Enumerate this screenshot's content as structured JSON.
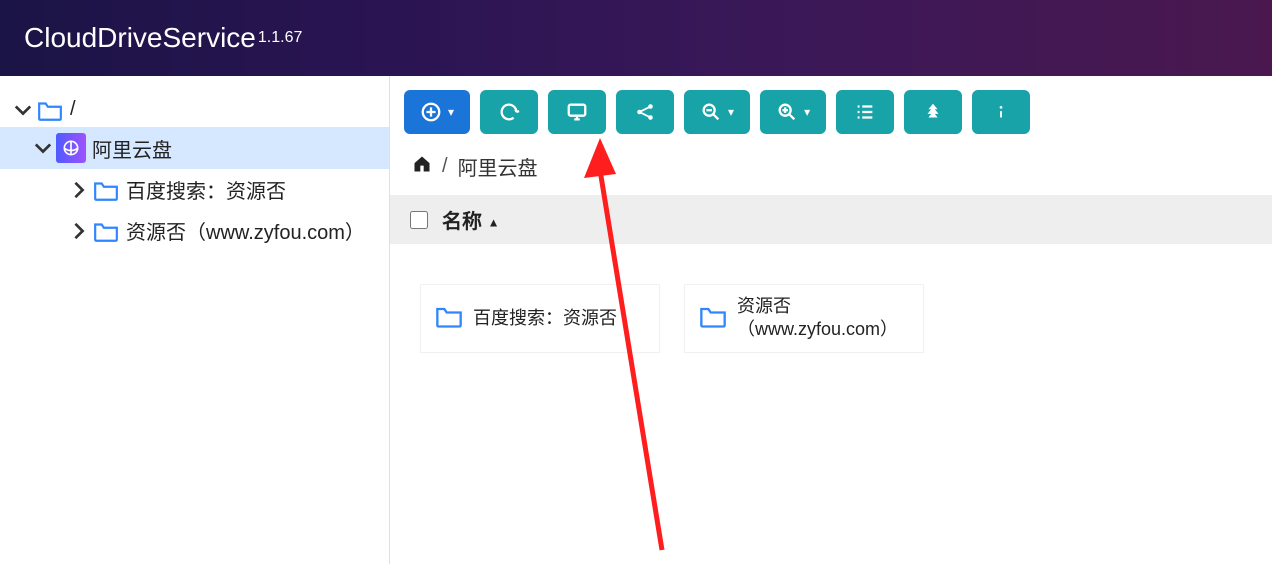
{
  "header": {
    "title": "CloudDriveService",
    "version": "1.1.67"
  },
  "sidebar": {
    "root": {
      "label": "/"
    },
    "active": {
      "label": "阿里云盘",
      "children": [
        {
          "label": "百度搜索：资源否"
        },
        {
          "label": "资源否（www.zyfou.com）"
        }
      ]
    }
  },
  "toolbar": {
    "buttons": [
      {
        "name": "add",
        "icon": "plus-circle",
        "hasCaret": true,
        "primary": true
      },
      {
        "name": "refresh",
        "icon": "refresh"
      },
      {
        "name": "mount",
        "icon": "monitor"
      },
      {
        "name": "share",
        "icon": "share"
      },
      {
        "name": "zoom-out",
        "icon": "zoom-out",
        "hasCaret": true
      },
      {
        "name": "zoom-in",
        "icon": "zoom-in",
        "hasCaret": true
      },
      {
        "name": "list-view",
        "icon": "list"
      },
      {
        "name": "tree",
        "icon": "tree"
      },
      {
        "name": "info",
        "icon": "info"
      }
    ]
  },
  "breadcrumb": {
    "sep": "/",
    "current": "阿里云盘"
  },
  "columns": {
    "name": "名称"
  },
  "files": [
    {
      "label": "百度搜索：资源否"
    },
    {
      "label": "资源否（www.zyfou.com）"
    }
  ]
}
